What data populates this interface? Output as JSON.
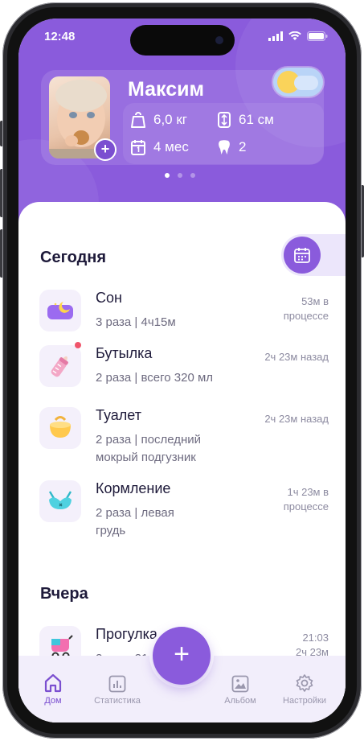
{
  "status_bar": {
    "time": "12:48"
  },
  "profile": {
    "name": "Максим",
    "weight": "6,0 кг",
    "height": "61 см",
    "age": "4 мес",
    "teeth": "2",
    "avatar_add": "+"
  },
  "today": {
    "title": "Сегодня",
    "items": [
      {
        "title": "Сон",
        "sub": "3 раза |  4ч15м",
        "time": "53м в процессе",
        "icon": "sleep-pillow-icon"
      },
      {
        "title": "Бутылка",
        "sub": " 2 раза |  всего 320 мл",
        "time": "2ч 23м назад",
        "icon": "baby-bottle-icon"
      },
      {
        "title": "Туалет",
        "sub": "2 раза | последний мокрый подгузник",
        "time": "2ч 23м назад",
        "icon": "potty-icon"
      },
      {
        "title": "Кормление",
        "sub": "2 раза | левая грудь",
        "time": "1ч 23м в процессе",
        "icon": "nursing-bra-icon"
      }
    ]
  },
  "yesterday": {
    "title": "Вчера",
    "items": [
      {
        "title": "Прогулка",
        "sub": "2 часа 21 м",
        "time1": "21:03",
        "time2": "2ч 23м",
        "icon": "stroller-icon"
      }
    ]
  },
  "fab": {
    "label": "+"
  },
  "tabbar": {
    "home": "Дом",
    "stats": "Статистика",
    "album": "Альбом",
    "settings": "Настройки"
  },
  "colors": {
    "accent": "#8a5bdc",
    "tab_active": "#7b4fd0",
    "badge": "#f0556b"
  }
}
